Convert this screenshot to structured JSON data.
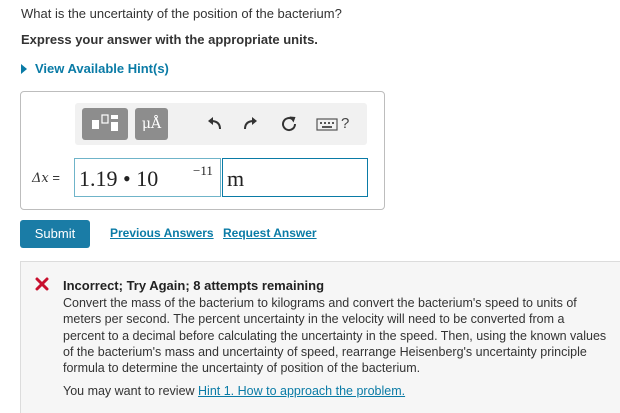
{
  "question": "What is the uncertainty of the position of the bacterium?",
  "instruction": "Express your answer with the appropriate units.",
  "hints_link": "View Available Hint(s)",
  "toolbar": {
    "units_button": "μÅ",
    "icons": [
      "templates-icon",
      "undo-icon",
      "redo-icon",
      "reset-icon",
      "keyboard-icon",
      "help-icon"
    ],
    "help_label": "?"
  },
  "answer": {
    "variable_symbol": "Δx",
    "equals": " =",
    "value_mantissa": "1.19 • 10",
    "value_exponent": "−11",
    "unit": "m"
  },
  "actions": {
    "submit": "Submit",
    "previous_answers": "Previous Answers",
    "request_answer": "Request Answer"
  },
  "feedback": {
    "title": "Incorrect; Try Again; 8 attempts remaining",
    "body": "Convert the mass of the bacterium to kilograms and convert the bacterium's speed to units of meters per second. The percent uncertainty in the velocity will need to be converted from a percent to a decimal before calculating the uncertainty in the speed. Then, using the known values of the bacterium's mass and uncertainty of speed, rearrange Heisenberg's uncertainty principle formula to determine the uncertainty of position of the bacterium.",
    "review_prefix": "You may want to review ",
    "review_link": "Hint 1. How to approach the problem.",
    "status_color": "#c8102e"
  },
  "colors": {
    "accent": "#0a7ba6",
    "submit_bg": "#1a7ca6",
    "toolbar_button": "#8d8d8d"
  }
}
